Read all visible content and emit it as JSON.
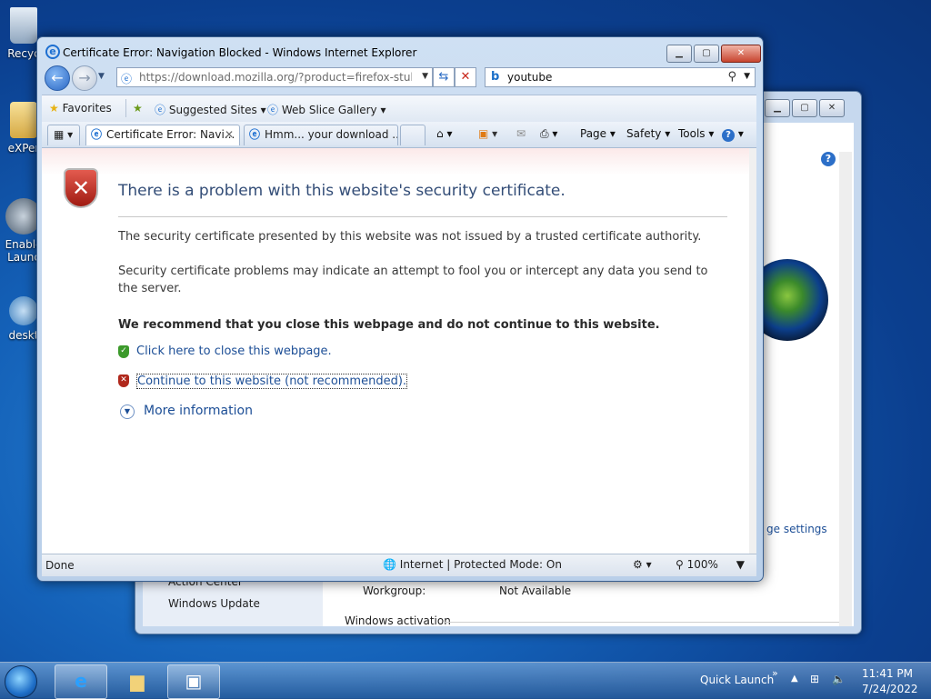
{
  "desktop": {
    "icons": [
      {
        "label": "Recyc",
        "icon": "recycle-bin-icon"
      },
      {
        "label": "eXPer",
        "icon": "folder-icon"
      },
      {
        "label": "Enable",
        "label2": "Launc",
        "icon": "launcher-icon"
      },
      {
        "label": "deskt",
        "icon": "gear-icon"
      }
    ]
  },
  "bg_window": {
    "left_links": [
      "Action Center",
      "Windows Update"
    ],
    "workgroup_label": "Workgroup:",
    "workgroup_value": "Not Available",
    "section": "Windows activation",
    "change_settings": "ge settings"
  },
  "ie": {
    "title": "Certificate Error: Navigation Blocked - Windows Internet Explorer",
    "address": "https://download.mozilla.org/?product=firefox-stub&os=",
    "search_value": "youtube",
    "favbar": {
      "favorites": "Favorites",
      "suggested": "Suggested Sites",
      "webslice": "Web Slice Gallery"
    },
    "tabs": [
      {
        "label": "Certificate Error: Navi..."
      },
      {
        "label": "Hmm... your download ..."
      }
    ],
    "commands": {
      "page": "Page",
      "safety": "Safety",
      "tools": "Tools"
    },
    "content": {
      "heading": "There is a problem with this website's security certificate.",
      "p1": "The security certificate presented by this website was not issued by a trusted certificate authority.",
      "p2": "Security certificate problems may indicate an attempt to fool you or intercept any data you send to the server.",
      "recommend": "We recommend that you close this webpage and do not continue to this website.",
      "close_link": "Click here to close this webpage.",
      "continue_link": "Continue to this website (not recommended).",
      "more_info": "More information"
    },
    "status": {
      "done": "Done",
      "zone": "Internet | Protected Mode: On",
      "zoom": "100%"
    }
  },
  "taskbar": {
    "quick_launch": "Quick Launch",
    "time": "11:41 PM",
    "date": "7/24/2022"
  }
}
